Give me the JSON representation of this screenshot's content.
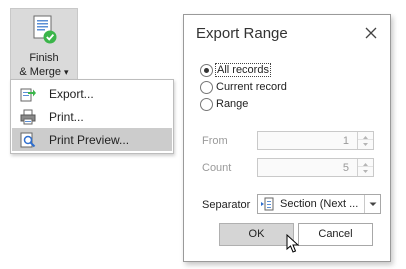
{
  "ribbon": {
    "finish_merge_line1": "Finish",
    "finish_merge_line2": "& Merge",
    "dropdown_arrow": "▾",
    "icon": "finish-merge-icon"
  },
  "menu": {
    "items": [
      {
        "label": "Export...",
        "icon": "export-icon",
        "selected": false
      },
      {
        "label": "Print...",
        "icon": "printer-icon",
        "selected": false
      },
      {
        "label": "Print Preview...",
        "icon": "print-preview-icon",
        "selected": true
      }
    ]
  },
  "dialog": {
    "title": "Export Range",
    "close_glyph": "✕",
    "range_options": [
      {
        "label": "All records",
        "checked": true
      },
      {
        "label": "Current record",
        "checked": false
      },
      {
        "label": "Range",
        "checked": false
      }
    ],
    "from_label": "From",
    "from_value": "1",
    "count_label": "Count",
    "count_value": "5",
    "separator_label": "Separator",
    "separator_value": "Section (Next ...",
    "ok_label": "OK",
    "cancel_label": "Cancel"
  },
  "colors": {
    "ribbon_bg": "#dadada",
    "menu_selected": "#cccccc",
    "ok_bg": "#d5d5d5",
    "disabled_text": "#9a9a9a"
  }
}
